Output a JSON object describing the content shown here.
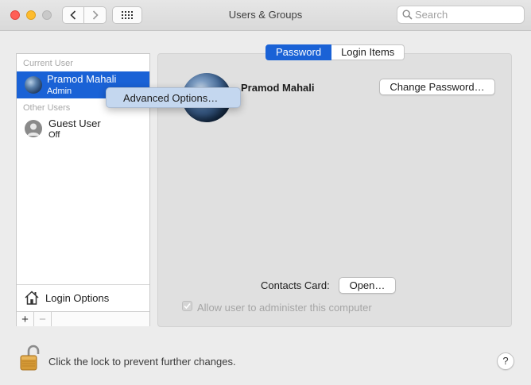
{
  "window": {
    "title": "Users & Groups",
    "search_placeholder": "Search"
  },
  "sidebar": {
    "current_user_label": "Current User",
    "other_users_label": "Other Users",
    "users": [
      {
        "name": "Pramod Mahali",
        "role": "Admin",
        "selected": true,
        "avatar": "earth-avatar"
      },
      {
        "name": "Guest User",
        "role": "Off",
        "selected": false,
        "avatar": "guest-avatar"
      }
    ],
    "login_options_label": "Login Options",
    "add_label": "+",
    "remove_label": "−"
  },
  "context_menu": {
    "items": [
      "Advanced Options…"
    ]
  },
  "main": {
    "tabs": [
      {
        "label": "Password",
        "active": true
      },
      {
        "label": "Login Items",
        "active": false
      }
    ],
    "user_full_name": "Pramod Mahali",
    "change_password_label": "Change Password…",
    "contacts_card_label": "Contacts Card:",
    "open_label": "Open…",
    "allow_admin_label": "Allow user to administer this computer",
    "allow_admin_checked": true
  },
  "footer": {
    "lock_text": "Click the lock to prevent further changes.",
    "help_label": "?"
  },
  "colors": {
    "accent": "#1a62d6",
    "window_bg": "#ececec",
    "panel_bg": "#e0e0e0"
  }
}
